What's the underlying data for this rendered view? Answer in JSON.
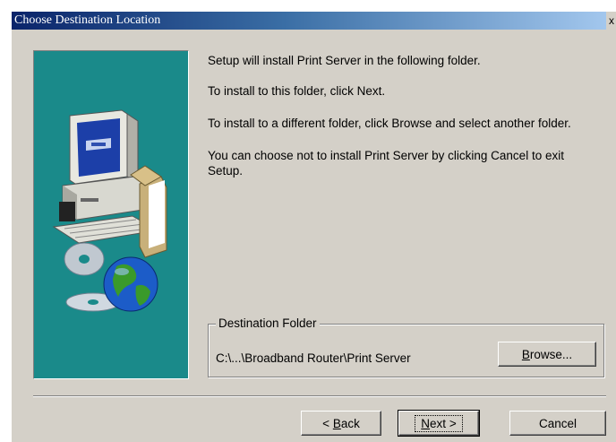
{
  "window": {
    "title": "Choose Destination Location",
    "close_label": "x"
  },
  "content": {
    "line1": "Setup will install Print Server in the following folder.",
    "line2": "To install to this folder, click Next.",
    "line3": "To install to a different folder, click Browse and select another folder.",
    "line4": "You can choose not to install Print Server by clicking Cancel to exit Setup."
  },
  "destination": {
    "legend": "Destination Folder",
    "path": "C:\\...\\Broadband Router\\Print Server",
    "browse_label_accel": "B",
    "browse_label_rest": "rowse..."
  },
  "footer": {
    "back_symbol": "<",
    "back_accel": "B",
    "back_rest": "ack",
    "next_accel": "N",
    "next_rest": "ext",
    "next_symbol": ">",
    "cancel_label": "Cancel"
  },
  "colors": {
    "dialog_bg": "#d4d0c8",
    "side_panel_bg": "#1a8a8a",
    "title_gradient_start": "#0a246a"
  },
  "icons": {
    "illustration": "computer-with-globe-and-cds-icon"
  }
}
